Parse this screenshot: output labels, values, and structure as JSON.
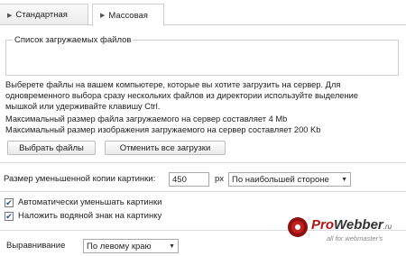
{
  "tabs": [
    {
      "label": "Стандартная"
    },
    {
      "label": "Массовая"
    }
  ],
  "file_list": {
    "legend": "Список загружаемых файлов"
  },
  "instructions": {
    "line1": "Выберете файлы на вашем компьютере, которые вы хотите загрузить на сервер. Для",
    "line2": "одновременного выбора сразу нескольких файлов из директории используйте выделение",
    "line3": "мышкой или удерживайте клавишу Ctrl."
  },
  "limits": {
    "file": "Максимальный размер файла загружаемого на сервер составляет 4 Mb",
    "image": "Максимальный размер изображения загружаемого на сервер составляет 200 Kb"
  },
  "buttons": {
    "choose": "Выбрать файлы",
    "cancel_all": "Отменить все загрузки"
  },
  "thumb": {
    "label": "Размер уменьшенной копии картинки:",
    "value": "450",
    "unit": "px",
    "mode": "По наибольшей стороне"
  },
  "options": {
    "auto_resize": {
      "label": "Автоматически уменьшать картинки",
      "checked": true
    },
    "watermark": {
      "label": "Наложить водяной знак на картинку",
      "checked": true
    }
  },
  "align": {
    "label": "Выравнивание",
    "value": "По левому краю"
  },
  "brand": {
    "pro": "Pro",
    "webber": "Webber",
    "ru": ".ru",
    "tagline": "all for webmaster's"
  }
}
